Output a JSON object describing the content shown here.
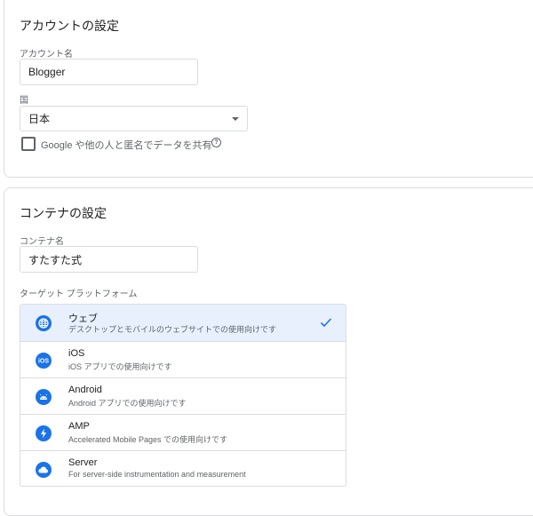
{
  "account_section": {
    "title": "アカウントの設定",
    "name_label": "アカウント名",
    "name_value": "Blogger",
    "country_label": "国",
    "country_value": "日本",
    "share_label": "Google や他の人と匿名でデータを共有",
    "help_icon": "?"
  },
  "container_section": {
    "title": "コンテナの設定",
    "name_label": "コンテナ名",
    "name_value": "すたすた式",
    "platform_label": "ターゲット プラットフォーム",
    "platforms": [
      {
        "name": "ウェブ",
        "desc": "デスクトップとモバイルのウェブサイトでの使用向けです",
        "icon": "globe-icon",
        "selected": true
      },
      {
        "name": "iOS",
        "desc": "iOS アプリでの使用向けです",
        "icon": "ios-icon",
        "selected": false
      },
      {
        "name": "Android",
        "desc": "Android アプリでの使用向けです",
        "icon": "android-icon",
        "selected": false
      },
      {
        "name": "AMP",
        "desc": "Accelerated Mobile Pages での使用向けです",
        "icon": "bolt-icon",
        "selected": false
      },
      {
        "name": "Server",
        "desc": "For server-side instrumentation and measurement",
        "icon": "cloud-icon",
        "selected": false
      }
    ]
  },
  "colors": {
    "accent": "#1a73e8",
    "selected_bg": "#e8f0fe",
    "border": "#dadce0"
  }
}
